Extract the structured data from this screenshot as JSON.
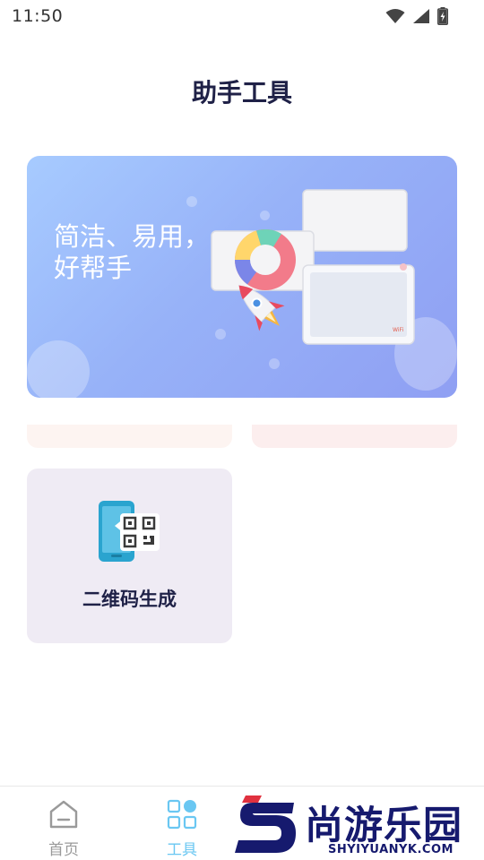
{
  "status_bar": {
    "time": "11:50",
    "icons": [
      "wifi-icon",
      "signal-icon",
      "battery-charging-icon"
    ]
  },
  "header": {
    "title": "助手工具"
  },
  "banner": {
    "slogan_line1": "简洁、易用，",
    "slogan_line2": "好帮手",
    "colors": {
      "gradient_start": "#a7cbff",
      "gradient_end": "#8f9ff3"
    }
  },
  "tools": [
    {
      "label": "二维码生成",
      "icon": "qr-code-phone-icon"
    }
  ],
  "bottom_nav": {
    "items": [
      {
        "label": "首页",
        "icon": "home-icon",
        "active": false
      },
      {
        "label": "工具",
        "icon": "grid-icon",
        "active": true
      }
    ],
    "colors": {
      "active": "#6ac7f2",
      "inactive": "#9a9a9a"
    }
  },
  "watermark": {
    "text": "尚游乐园",
    "subtext": "SHYIYUANYK.COM"
  }
}
